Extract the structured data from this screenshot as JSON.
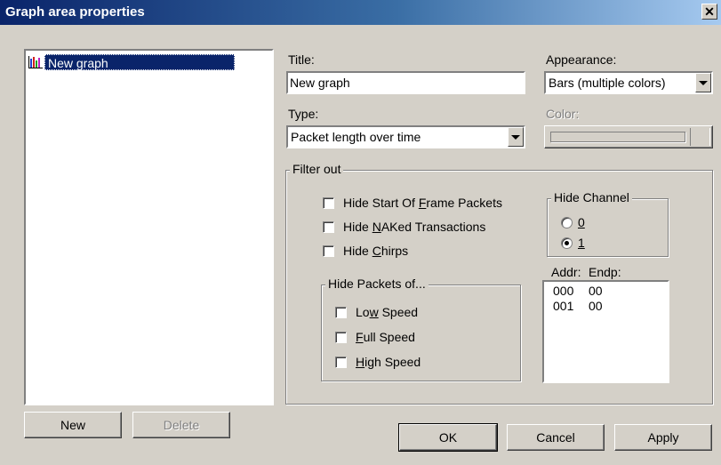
{
  "window": {
    "title": "Graph area properties",
    "close_glyph": "✕"
  },
  "tree": {
    "items": [
      {
        "label": "New graph",
        "icon": "bar-chart-icon"
      }
    ]
  },
  "left_buttons": {
    "new_label": "New",
    "delete_label": "Delete"
  },
  "form": {
    "title_label": "Title:",
    "title_value": "New graph",
    "type_label": "Type:",
    "type_value": "Packet length over time",
    "appearance_label": "Appearance:",
    "appearance_value": "Bars (multiple colors)",
    "color_label": "Color:"
  },
  "filter": {
    "group_title": "Filter out",
    "hide_sof": {
      "pre": "Hide Start Of ",
      "ul": "F",
      "post": "rame Packets",
      "checked": false
    },
    "hide_naked": {
      "pre": "Hide ",
      "ul": "N",
      "post": "AKed Transactions",
      "checked": false
    },
    "hide_chirps": {
      "pre": "Hide ",
      "ul": "C",
      "post": "hirps",
      "checked": false
    },
    "packets_group_title": "Hide Packets of...",
    "low_speed": {
      "pre": "Lo",
      "ul": "w",
      "post": " Speed",
      "checked": false
    },
    "full_speed": {
      "pre": "",
      "ul": "F",
      "post": "ull Speed",
      "checked": false
    },
    "high_speed": {
      "pre": "",
      "ul": "H",
      "post": "igh Speed",
      "checked": false
    },
    "channel_group_title": "Hide Channel",
    "channel_0": {
      "label": "0",
      "checked": false
    },
    "channel_1": {
      "label": "1",
      "checked": true
    },
    "addr_header": "Addr:",
    "endp_header": "Endp:",
    "endpoints": [
      {
        "addr": "000",
        "endp": "00"
      },
      {
        "addr": "001",
        "endp": "00"
      }
    ]
  },
  "footer": {
    "ok_label": "OK",
    "cancel_label": "Cancel",
    "apply_label": "Apply"
  }
}
